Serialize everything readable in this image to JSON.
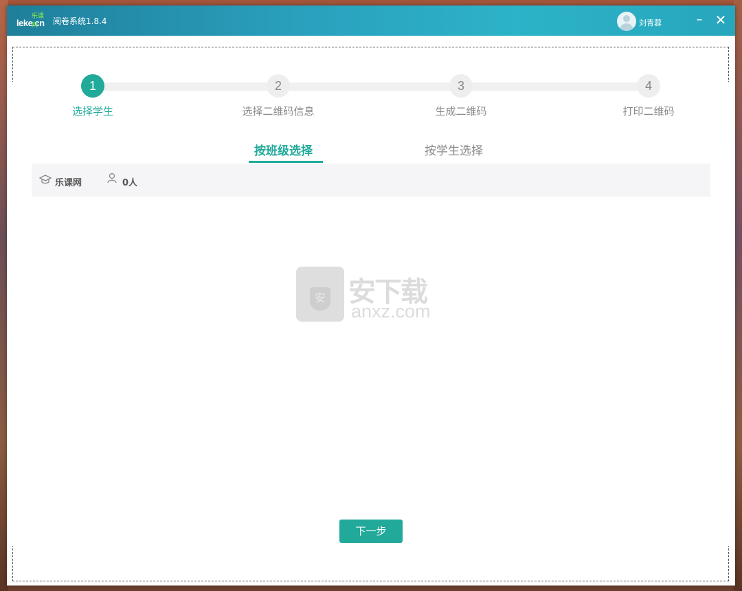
{
  "titlebar": {
    "logo_text": "leke.cn",
    "logo_cn": "乐课网",
    "app_title": "阅卷系统1.8.4",
    "username": "刘青蓉",
    "minimize_label": "–",
    "close_label": "✕"
  },
  "steps": [
    {
      "number": "1",
      "label": "选择学生",
      "active": true
    },
    {
      "number": "2",
      "label": "选择二维码信息",
      "active": false
    },
    {
      "number": "3",
      "label": "生成二维码",
      "active": false
    },
    {
      "number": "4",
      "label": "打印二维码",
      "active": false
    }
  ],
  "tabs": {
    "by_class": "按班级选择",
    "by_student": "按学生选择"
  },
  "class_row": {
    "school": "乐课网",
    "count": "0人"
  },
  "watermark": {
    "cn": "安下载",
    "en": "anxz.com",
    "shield": "安"
  },
  "actions": {
    "next_label": "下一步"
  },
  "colors": {
    "accent": "#21a99a",
    "titlebar": "#2aa0bd"
  }
}
